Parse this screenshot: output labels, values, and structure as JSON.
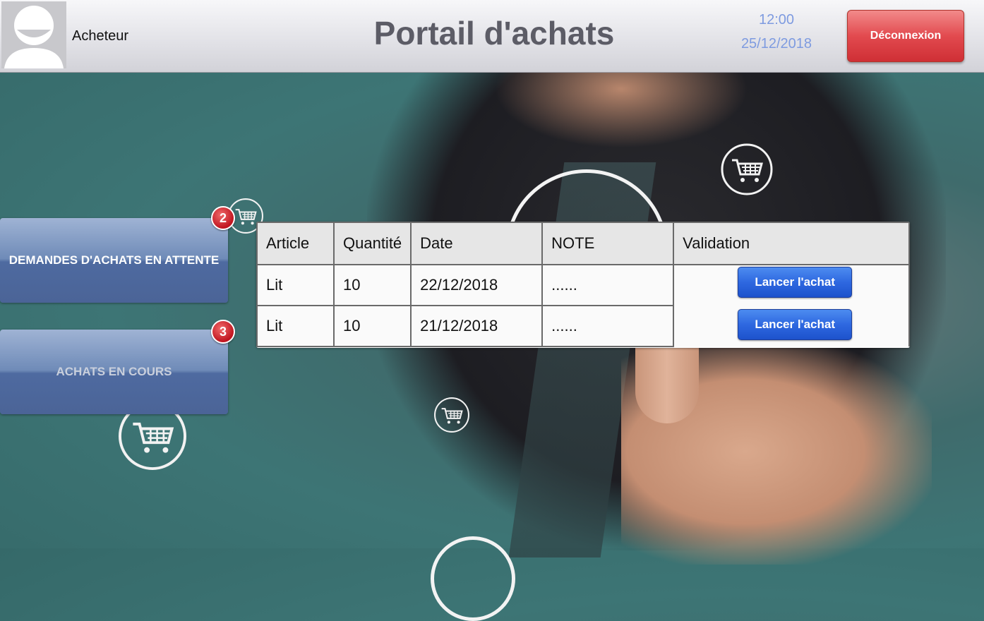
{
  "header": {
    "user_role": "Acheteur",
    "title": "Portail d'achats",
    "time": "12:00",
    "date": "25/12/2018",
    "logout_label": "Déconnexion"
  },
  "sidebar": {
    "items": [
      {
        "label": "DEMANDES D'ACHATS EN ATTENTE",
        "badge": "2"
      },
      {
        "label": "ACHATS EN COURS",
        "badge": "3"
      }
    ]
  },
  "table": {
    "columns": [
      "Article",
      "Quantité",
      "Date",
      "NOTE",
      "Validation"
    ],
    "rows": [
      {
        "article": "Lit",
        "quantite": "10",
        "date": "22/12/2018",
        "note": "......",
        "action": "Lancer l'achat"
      },
      {
        "article": "Lit",
        "quantite": "10",
        "date": "21/12/2018",
        "note": "......",
        "action": "Lancer l'achat"
      }
    ]
  },
  "colors": {
    "logout": "#dd3b41",
    "launch": "#2e68e0",
    "nav": "#5a76a8",
    "badge": "#c0141f",
    "clock": "#7e9be0"
  },
  "icons": [
    "avatar-icon",
    "cart-icon"
  ]
}
